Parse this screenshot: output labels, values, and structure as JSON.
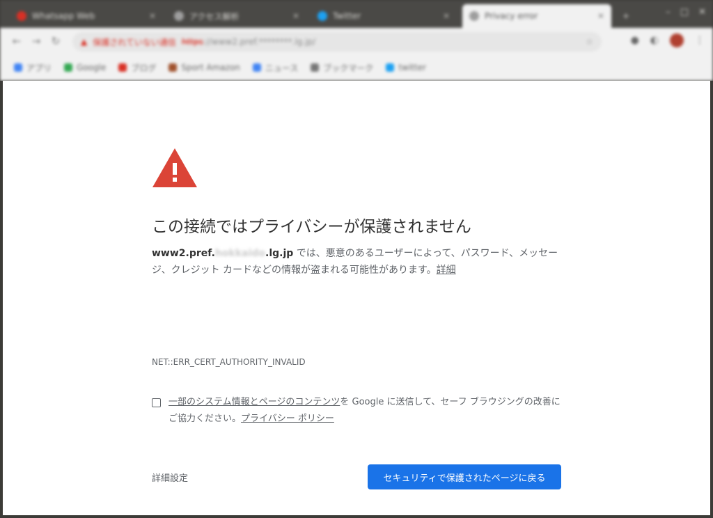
{
  "chrome": {
    "tabs": [
      {
        "label": "Whatsapp Web",
        "color": "#d93025",
        "active": false
      },
      {
        "label": "アクセス解析",
        "color": "#9e9e9e",
        "active": false
      },
      {
        "label": "Twitter",
        "color": "#1da1f2",
        "active": false
      },
      {
        "label": "Privacy error",
        "color": "#9e9e9e",
        "active": true
      }
    ],
    "omnibox": {
      "security_label": "保護されていない通信",
      "scheme": "https",
      "url_rest": "://www2.pref.********.lg.jp/"
    },
    "bookmarks": [
      {
        "label": "アプリ",
        "color": "#4285f4"
      },
      {
        "label": "Google",
        "color": "#34a853"
      },
      {
        "label": "ブログ",
        "color": "#d93025"
      },
      {
        "label": "Sport Amazon",
        "color": "#a0522d"
      },
      {
        "label": "ニュース",
        "color": "#4285f4"
      },
      {
        "label": "ブックマーク",
        "color": "#777777"
      },
      {
        "label": "twitter",
        "color": "#1da1f2"
      }
    ]
  },
  "error_page": {
    "title": "この接続ではプライバシーが保護されません",
    "domain_prefix": "www2.pref.",
    "domain_hidden": "hokkaido",
    "domain_suffix": ".lg.jp",
    "description": " では、悪意のあるユーザーによって、パスワード、メッセージ、クレジット カードなどの情報が盗まれる可能性があります。",
    "details_link": "詳細",
    "error_code": "NET::ERR_CERT_AUTHORITY_INVALID",
    "checkbox_link": "一部のシステム情報とページのコンテンツ",
    "checkbox_text": "を Google に送信して、セーフ ブラウジングの改善にご協力ください。",
    "privacy_link": "プライバシー ポリシー",
    "advanced_label": "詳細設定",
    "back_button_label": "セキュリティで保護されたページに戻る",
    "colors": {
      "warning_red": "#db4437",
      "button_blue": "#1a73e8"
    }
  }
}
